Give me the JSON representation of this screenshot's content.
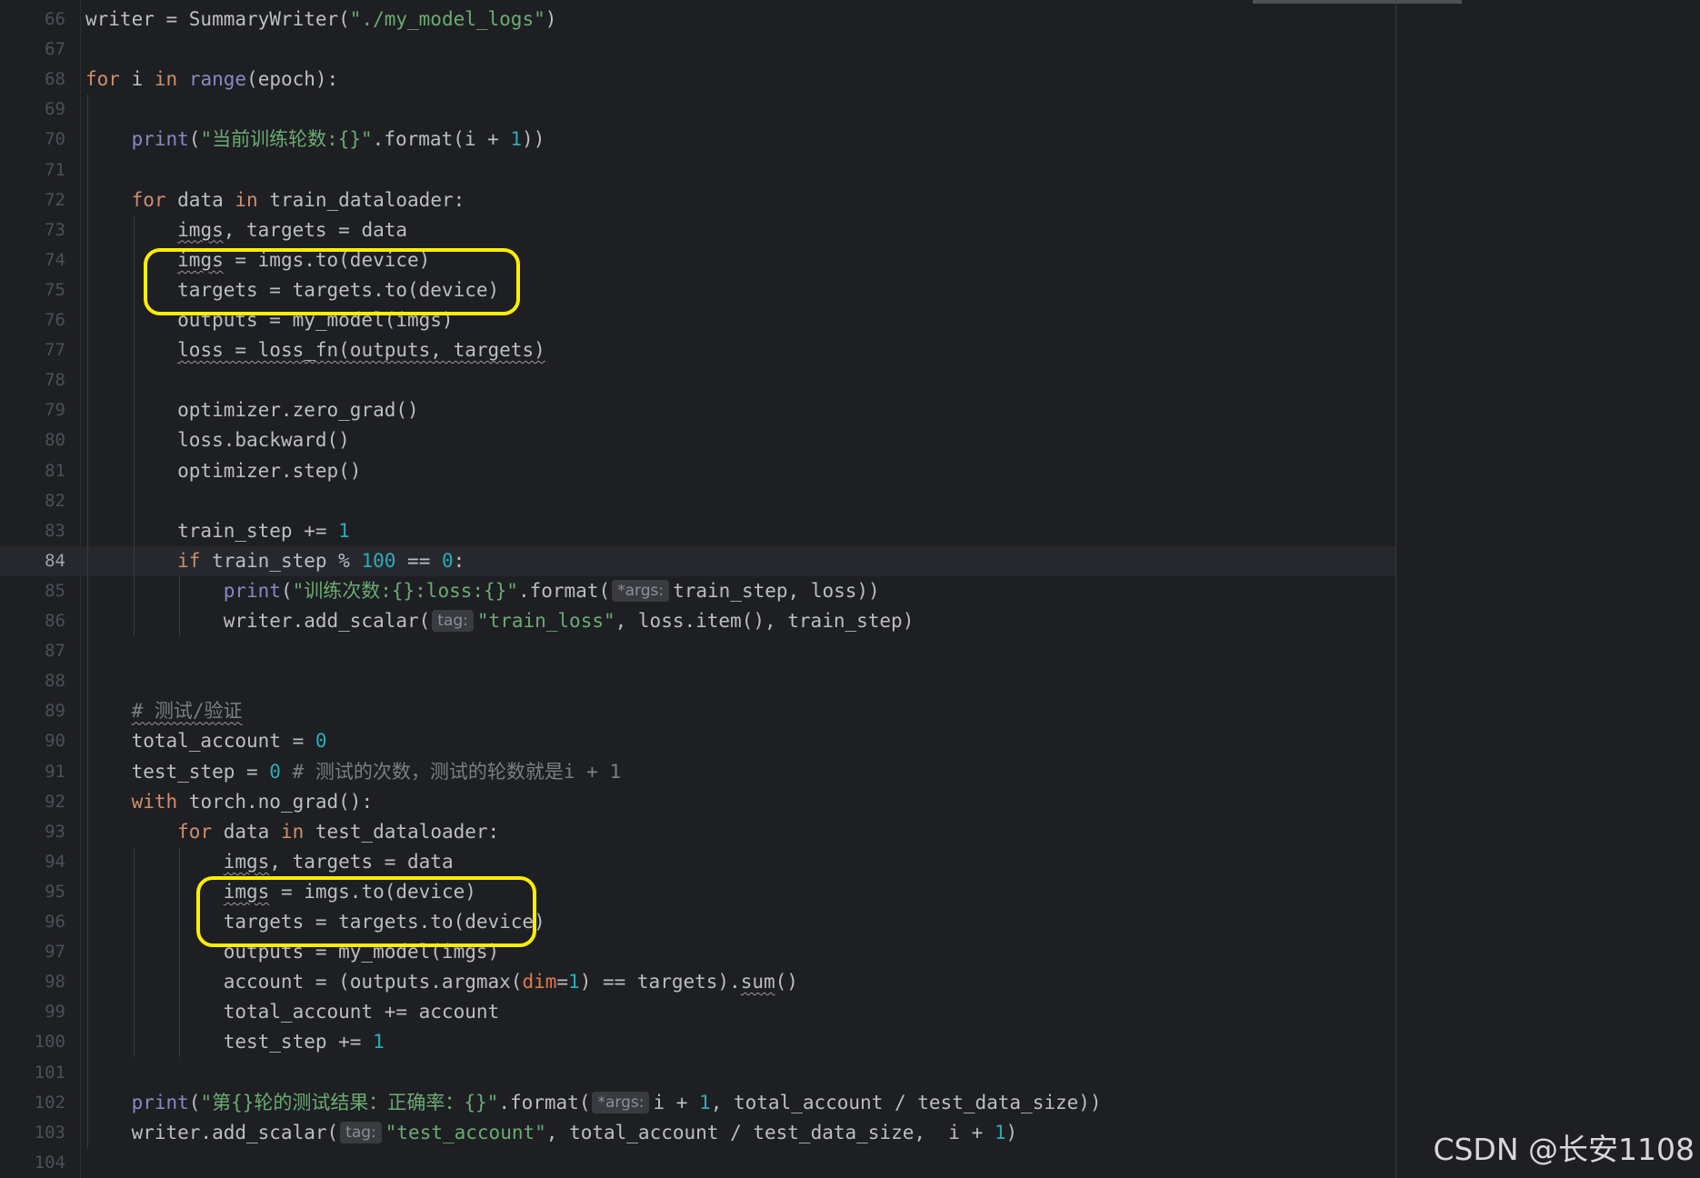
{
  "editor": {
    "active_line": "84",
    "watermark": "CSDN @长安1108"
  },
  "lines": [
    {
      "no": "66",
      "tokens": [
        [
          "writer = SummaryWriter(",
          ""
        ],
        [
          "\"./my_model_logs\"",
          "str"
        ],
        [
          ")",
          ""
        ]
      ]
    },
    {
      "no": "67",
      "tokens": []
    },
    {
      "no": "68",
      "tokens": [
        [
          "for",
          "kw"
        ],
        [
          " i ",
          ""
        ],
        [
          "in",
          "kw"
        ],
        [
          " ",
          ""
        ],
        [
          "range",
          "bi"
        ],
        [
          "(epoch):",
          ""
        ]
      ]
    },
    {
      "no": "69",
      "tokens": []
    },
    {
      "no": "70",
      "tokens": [
        [
          "    ",
          ""
        ],
        [
          "print",
          "bi"
        ],
        [
          "(",
          ""
        ],
        [
          "\"当前训练轮数:{}\"",
          "str"
        ],
        [
          ".format(i + ",
          ""
        ],
        [
          "1",
          "num"
        ],
        [
          "))",
          ""
        ]
      ]
    },
    {
      "no": "71",
      "tokens": []
    },
    {
      "no": "72",
      "tokens": [
        [
          "    ",
          ""
        ],
        [
          "for",
          "kw"
        ],
        [
          " data ",
          ""
        ],
        [
          "in",
          "kw"
        ],
        [
          " train_dataloader:",
          ""
        ]
      ]
    },
    {
      "no": "73",
      "tokens": [
        [
          "        ",
          ""
        ],
        [
          "imgs",
          "squig"
        ],
        [
          ", targets = data",
          ""
        ]
      ]
    },
    {
      "no": "74",
      "tokens": [
        [
          "        ",
          ""
        ],
        [
          "imgs",
          "squig"
        ],
        [
          " = imgs.to(device)",
          ""
        ]
      ]
    },
    {
      "no": "75",
      "tokens": [
        [
          "        targets = targets.to(device)",
          ""
        ]
      ]
    },
    {
      "no": "76",
      "tokens": [
        [
          "        outputs = my_model(imgs)",
          ""
        ]
      ]
    },
    {
      "no": "77",
      "tokens": [
        [
          "        ",
          ""
        ],
        [
          "loss = loss_fn(outputs, targets)",
          "squig"
        ]
      ]
    },
    {
      "no": "78",
      "tokens": []
    },
    {
      "no": "79",
      "tokens": [
        [
          "        optimizer.zero_grad()",
          ""
        ]
      ]
    },
    {
      "no": "80",
      "tokens": [
        [
          "        loss.backward()",
          ""
        ]
      ]
    },
    {
      "no": "81",
      "tokens": [
        [
          "        optimizer.step()",
          ""
        ]
      ]
    },
    {
      "no": "82",
      "tokens": []
    },
    {
      "no": "83",
      "tokens": [
        [
          "        train_step += ",
          ""
        ],
        [
          "1",
          "num"
        ]
      ]
    },
    {
      "no": "84",
      "tokens": [
        [
          "        ",
          ""
        ],
        [
          "if",
          "kw"
        ],
        [
          " train_step % ",
          ""
        ],
        [
          "100",
          "num"
        ],
        [
          " == ",
          ""
        ],
        [
          "0",
          "num"
        ],
        [
          ":",
          ""
        ]
      ]
    },
    {
      "no": "85",
      "tokens": [
        [
          "            ",
          ""
        ],
        [
          "print",
          "bi"
        ],
        [
          "(",
          ""
        ],
        [
          "\"训练次数:{}:loss:{}\"",
          "str"
        ],
        [
          ".format(",
          ""
        ],
        [
          "*args:",
          "hint"
        ],
        [
          "train_step, loss))",
          ""
        ]
      ]
    },
    {
      "no": "86",
      "tokens": [
        [
          "            writer.add_scalar(",
          ""
        ],
        [
          "tag:",
          "hint"
        ],
        [
          "\"train_loss\"",
          "str"
        ],
        [
          ", loss.item(), train_step)",
          ""
        ]
      ]
    },
    {
      "no": "87",
      "tokens": []
    },
    {
      "no": "88",
      "tokens": []
    },
    {
      "no": "89",
      "tokens": [
        [
          "    ",
          ""
        ],
        [
          "# 测试/验证",
          "cmt squig"
        ]
      ]
    },
    {
      "no": "90",
      "tokens": [
        [
          "    total_account = ",
          ""
        ],
        [
          "0",
          "num"
        ]
      ]
    },
    {
      "no": "91",
      "tokens": [
        [
          "    test_step = ",
          ""
        ],
        [
          "0",
          "num"
        ],
        [
          " ",
          ""
        ],
        [
          "# 测试的次数，测试的轮数就是i + 1",
          "cmt"
        ]
      ]
    },
    {
      "no": "92",
      "tokens": [
        [
          "    ",
          ""
        ],
        [
          "with",
          "kw"
        ],
        [
          " torch.no_grad():",
          ""
        ]
      ]
    },
    {
      "no": "93",
      "tokens": [
        [
          "        ",
          ""
        ],
        [
          "for",
          "kw"
        ],
        [
          " data ",
          ""
        ],
        [
          "in",
          "kw"
        ],
        [
          " test_dataloader:",
          ""
        ]
      ]
    },
    {
      "no": "94",
      "tokens": [
        [
          "            ",
          ""
        ],
        [
          "imgs",
          "squig"
        ],
        [
          ", targets = data",
          ""
        ]
      ]
    },
    {
      "no": "95",
      "tokens": [
        [
          "            ",
          ""
        ],
        [
          "imgs",
          "squig"
        ],
        [
          " = imgs.to(device)",
          ""
        ]
      ]
    },
    {
      "no": "96",
      "tokens": [
        [
          "            targets = targets.to(device)",
          ""
        ]
      ]
    },
    {
      "no": "97",
      "tokens": [
        [
          "            outputs = my_model(imgs)",
          ""
        ]
      ]
    },
    {
      "no": "98",
      "tokens": [
        [
          "            account = (outputs.argmax(",
          ""
        ],
        [
          "dim",
          "param"
        ],
        [
          "=",
          ""
        ],
        [
          "1",
          "num"
        ],
        [
          ") == targets).",
          ""
        ],
        [
          "sum",
          "squig"
        ],
        [
          "()",
          ""
        ]
      ]
    },
    {
      "no": "99",
      "tokens": [
        [
          "            total_account += account",
          ""
        ]
      ]
    },
    {
      "no": "100",
      "tokens": [
        [
          "            test_step += ",
          ""
        ],
        [
          "1",
          "num"
        ]
      ]
    },
    {
      "no": "101",
      "tokens": []
    },
    {
      "no": "102",
      "tokens": [
        [
          "    ",
          ""
        ],
        [
          "print",
          "bi"
        ],
        [
          "(",
          ""
        ],
        [
          "\"第{}轮的测试结果：正确率：{}\"",
          "str"
        ],
        [
          ".format(",
          ""
        ],
        [
          "*args:",
          "hint"
        ],
        [
          "i + ",
          ""
        ],
        [
          "1",
          "num"
        ],
        [
          ", total_account / test_data_size))",
          ""
        ]
      ]
    },
    {
      "no": "103",
      "tokens": [
        [
          "    writer.add_scalar(",
          ""
        ],
        [
          "tag:",
          "hint"
        ],
        [
          "\"test_account\"",
          "str"
        ],
        [
          ", total_account / test_data_size,  i + ",
          ""
        ],
        [
          "1",
          "num"
        ],
        [
          ")",
          ""
        ]
      ]
    },
    {
      "no": "104",
      "tokens": []
    }
  ]
}
